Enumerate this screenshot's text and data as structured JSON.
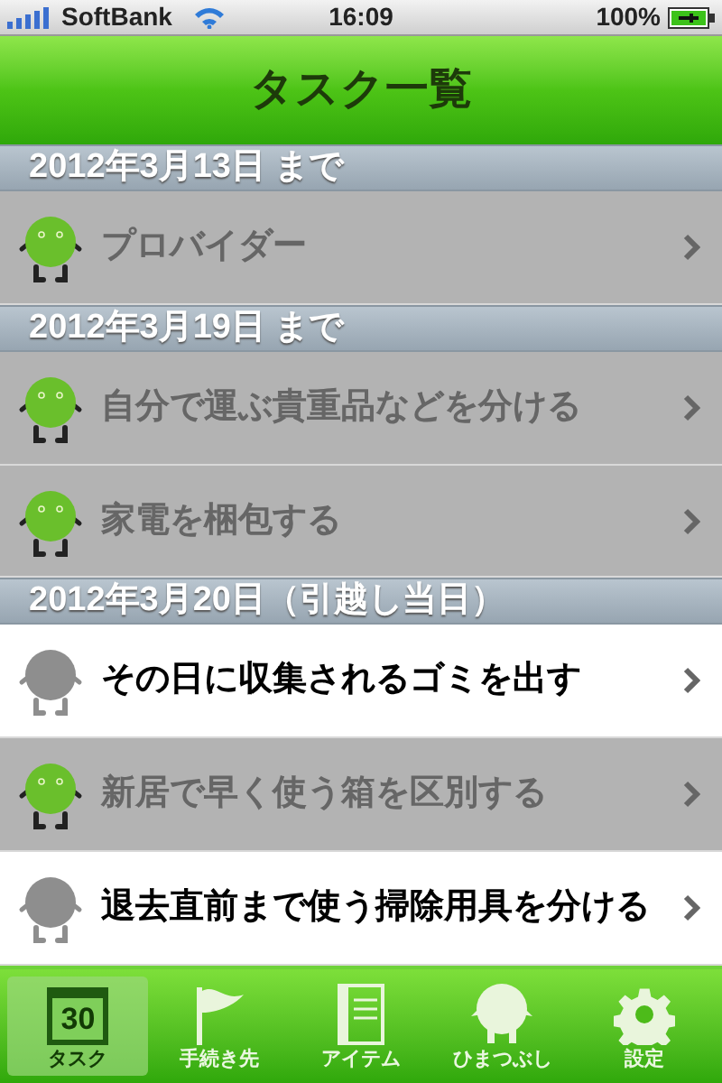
{
  "status_bar": {
    "carrier": "SoftBank",
    "time": "16:09",
    "battery": "100%"
  },
  "nav_bar": {
    "title": "タスク一覧"
  },
  "sections": [
    {
      "header": "2012年3月13日 まで",
      "tasks": [
        {
          "title": "プロバイダー",
          "done": true
        }
      ]
    },
    {
      "header": "2012年3月19日 まで",
      "tasks": [
        {
          "title": "自分で運ぶ貴重品などを分ける",
          "done": true
        },
        {
          "title": "家電を梱包する",
          "done": true
        }
      ]
    },
    {
      "header": "2012年3月20日（引越し当日）",
      "tasks": [
        {
          "title": "その日に収集されるゴミを出す",
          "done": false
        },
        {
          "title": "新居で早く使う箱を区別する",
          "done": true
        },
        {
          "title": "退去直前まで使う掃除用具を分ける",
          "done": false
        }
      ]
    }
  ],
  "tab_bar": [
    {
      "kind": "calendar",
      "label": "タスク",
      "icon_text": "30",
      "selected": true
    },
    {
      "kind": "flag",
      "label": "手続き先",
      "selected": false
    },
    {
      "kind": "notebook",
      "label": "アイテム",
      "selected": false
    },
    {
      "kind": "character",
      "label": "ひまつぶし",
      "selected": false
    },
    {
      "kind": "gear",
      "label": "設定",
      "selected": false
    }
  ]
}
